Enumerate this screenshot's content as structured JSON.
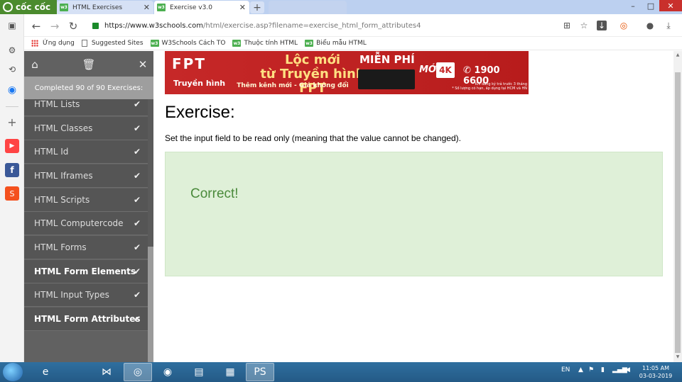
{
  "browser": {
    "brand": "cốc cốc",
    "tabs": [
      {
        "title": "HTML Exercises",
        "active": false
      },
      {
        "title": "Exercise v3.0",
        "active": true
      }
    ],
    "url": {
      "host": "https://www.w3schools.com",
      "path": "/html/exercise.asp?filename=exercise_html_form_attributes4"
    },
    "bookmarks": [
      {
        "label": "Ứng dụng",
        "icon": "apps-grid-icon"
      },
      {
        "label": "Suggested Sites",
        "icon": "page-icon"
      },
      {
        "label": "W3Schools Cách TO",
        "icon": "w3-icon"
      },
      {
        "label": "Thuộc tính HTML",
        "icon": "w3-icon"
      },
      {
        "label": "Biểu mẫu HTML",
        "icon": "w3-icon"
      }
    ],
    "favicon_text": "w3"
  },
  "exercise_sidebar": {
    "progress_text": "Completed 90 of 90 Exercises:",
    "items": [
      {
        "label": "HTML Lists",
        "completed": true
      },
      {
        "label": "HTML Classes",
        "completed": true
      },
      {
        "label": "HTML Id",
        "completed": true
      },
      {
        "label": "HTML Iframes",
        "completed": true
      },
      {
        "label": "HTML Scripts",
        "completed": true
      },
      {
        "label": "HTML Computercode",
        "completed": true
      },
      {
        "label": "HTML Forms",
        "completed": true
      },
      {
        "label": "HTML Form Elements",
        "completed": true,
        "bold": true
      },
      {
        "label": "HTML Input Types",
        "completed": true
      },
      {
        "label": "HTML Form Attributes",
        "completed": true,
        "bold": true
      }
    ]
  },
  "ad": {
    "brand": "FPT",
    "sub": "Truyền hình",
    "headline_1": "Lộc mới",
    "headline_2": "từ Truyền hình FPT",
    "tagline": "Thêm kênh mới - Giá không đổi",
    "free": "MIỄN PHÍ",
    "moi": "MỚI",
    "k4": "4K",
    "phone": "1900 6600",
    "fine_1": "* Khi đăng ký trả trước 3 tháng",
    "fine_2": "* Số lượng có hạn, áp dụng tại HCM và HN"
  },
  "main": {
    "title": "Exercise:",
    "description": "Set the input field to be read only (meaning that the value cannot be changed).",
    "result": "Correct!"
  },
  "taskbar": {
    "lang": "EN",
    "time": "11:05 AM",
    "date": "03-03-2019"
  },
  "colors": {
    "sidebar_bg": "#616161",
    "progress_bg": "#9e9e9e",
    "success_bg": "#dff0d8",
    "success_text": "#4a8a3b",
    "ad_red": "#c62828"
  }
}
